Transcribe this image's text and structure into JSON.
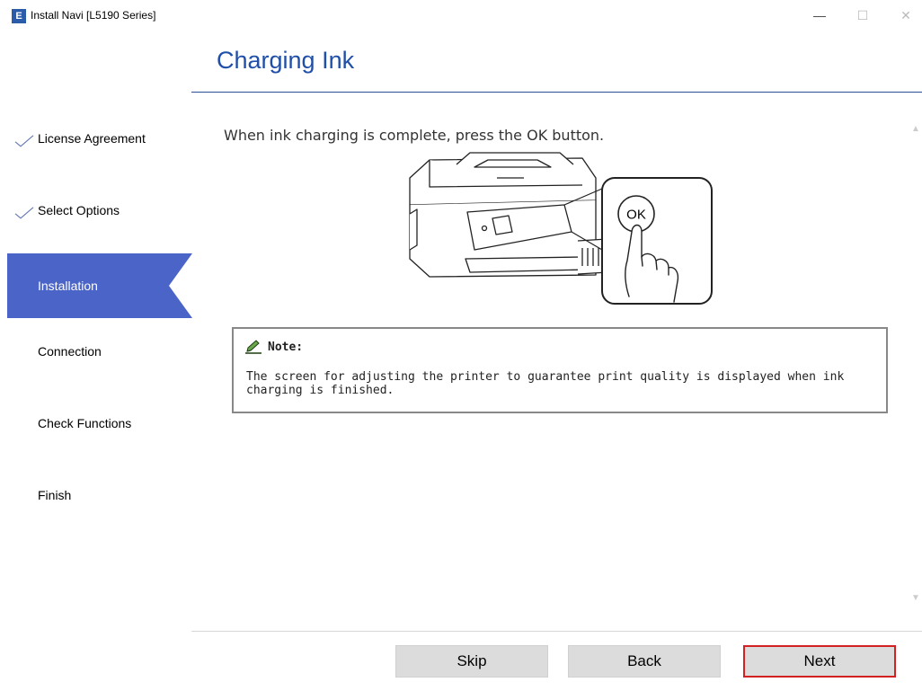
{
  "window": {
    "title": "Install Navi [L5190 Series]",
    "icon_letter": "E",
    "controls": {
      "minimize": "—",
      "maximize": "☐",
      "close": "✕"
    }
  },
  "header": {
    "title": "Charging Ink"
  },
  "sidebar": {
    "items": [
      {
        "label": "License Agreement",
        "state": "completed"
      },
      {
        "label": "Select Options",
        "state": "completed"
      },
      {
        "label": "Installation",
        "state": "active"
      },
      {
        "label": "Connection",
        "state": "pending"
      },
      {
        "label": "Check Functions",
        "state": "pending"
      },
      {
        "label": "Finish",
        "state": "pending"
      }
    ]
  },
  "main": {
    "instruction": "When ink charging is complete, press the OK button.",
    "illustration": {
      "button_label": "OK"
    },
    "note": {
      "title": "Note:",
      "body": "The screen for adjusting the printer to guarantee print quality is displayed when ink charging is finished."
    }
  },
  "footer": {
    "skip_label": "Skip",
    "back_label": "Back",
    "next_label": "Next"
  },
  "colors": {
    "accent": "#4a64c8",
    "header_text": "#1f4fa8",
    "highlight_border": "#d32020"
  },
  "icons": [
    "app-icon",
    "check-icon",
    "pencil-icon",
    "printer-illustration",
    "hand-pointer-icon"
  ]
}
